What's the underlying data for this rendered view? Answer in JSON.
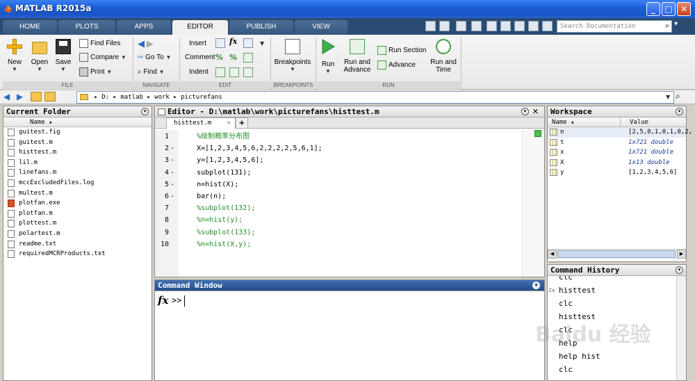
{
  "window": {
    "title": "MATLAB R2015a"
  },
  "tabs": [
    "HOME",
    "PLOTS",
    "APPS",
    "EDITOR",
    "PUBLISH",
    "VIEW"
  ],
  "search": {
    "placeholder": "Search Documentation"
  },
  "ribbon": {
    "file": {
      "new": "New",
      "open": "Open",
      "save": "Save",
      "find_files": "Find Files",
      "compare": "Compare",
      "print": "Print",
      "group": "FILE"
    },
    "navigate": {
      "go_to": "Go To",
      "find": "Find",
      "group": "NAVIGATE"
    },
    "edit": {
      "insert": "Insert",
      "comment": "Comment",
      "indent": "Indent",
      "group": "EDIT"
    },
    "breakpoints": {
      "label": "Breakpoints",
      "group": "BREAKPOINTS"
    },
    "run": {
      "run": "Run",
      "run_and_advance_1": "Run and",
      "run_and_advance_2": "Advance",
      "run_section": "Run Section",
      "advance": "Advance",
      "run_and_time_1": "Run and",
      "run_and_time_2": "Time",
      "group": "RUN"
    }
  },
  "address": {
    "drive": "D:",
    "parts": [
      "matlab",
      "work",
      "picturefans"
    ]
  },
  "current_folder": {
    "title": "Current Folder",
    "column": "Name",
    "files": [
      {
        "name": "guitest.fig",
        "type": "fig"
      },
      {
        "name": "guitest.m",
        "type": "m"
      },
      {
        "name": "histtest.m",
        "type": "m"
      },
      {
        "name": "lil.m",
        "type": "m"
      },
      {
        "name": "linefans.m",
        "type": "m"
      },
      {
        "name": "mccExcludedFiles.log",
        "type": "log"
      },
      {
        "name": "multest.m",
        "type": "m"
      },
      {
        "name": "plotfan.exe",
        "type": "exe"
      },
      {
        "name": "plotfan.m",
        "type": "m"
      },
      {
        "name": "plottest.m",
        "type": "m"
      },
      {
        "name": "polartest.m",
        "type": "m"
      },
      {
        "name": "readme.txt",
        "type": "txt"
      },
      {
        "name": "requiredMCRProducts.txt",
        "type": "txt"
      }
    ]
  },
  "editor": {
    "title": "Editor - D:\\matlab\\work\\picturefans\\histtest.m",
    "tab": "histtest.m",
    "lines": [
      {
        "n": "1",
        "dash": "",
        "code": "    %绘制概率分布图",
        "comment": true
      },
      {
        "n": "2",
        "dash": "-",
        "code": "    X=[1,2,3,4,5,6,2,2,2,2,5,6,1];",
        "comment": false
      },
      {
        "n": "3",
        "dash": "-",
        "code": "    y=[1,2,3,4,5,6];",
        "comment": false
      },
      {
        "n": "4",
        "dash": "-",
        "code": "    subplot(131);",
        "comment": false
      },
      {
        "n": "5",
        "dash": "-",
        "code": "    n=hist(X);",
        "comment": false
      },
      {
        "n": "6",
        "dash": "-",
        "code": "    bar(n);",
        "comment": false
      },
      {
        "n": "7",
        "dash": "",
        "code": "    %subplot(132);",
        "comment": true
      },
      {
        "n": "8",
        "dash": "",
        "code": "    %n=hist(y);",
        "comment": true
      },
      {
        "n": "9",
        "dash": "",
        "code": "    %subplot(133);",
        "comment": true
      },
      {
        "n": "10",
        "dash": "",
        "code": "    %n=hist(X,y);",
        "comment": true
      }
    ]
  },
  "command_window": {
    "title": "Command Window",
    "prompt": ">>"
  },
  "workspace": {
    "title": "Workspace",
    "col_name": "Name",
    "col_value": "Value",
    "vars": [
      {
        "name": "n",
        "value": "[2,5,0,1,0,1,0,2,",
        "italic": false
      },
      {
        "name": "t",
        "value": "1x721 double",
        "italic": true
      },
      {
        "name": "x",
        "value": "1x721 double",
        "italic": true
      },
      {
        "name": "X",
        "value": "1x13 double",
        "italic": true
      },
      {
        "name": "y",
        "value": "[1,2,3,4,5,6]",
        "italic": false
      }
    ]
  },
  "history": {
    "title": "Command History",
    "items": [
      {
        "text": "clc",
        "mark": ""
      },
      {
        "text": "histtest",
        "mark": "2x"
      },
      {
        "text": "clc",
        "mark": ""
      },
      {
        "text": "histtest",
        "mark": ""
      },
      {
        "text": "clc",
        "mark": ""
      },
      {
        "text": "help",
        "mark": ""
      },
      {
        "text": "help hist",
        "mark": ""
      },
      {
        "text": "clc",
        "mark": ""
      }
    ]
  },
  "watermark": "Baidu 经验"
}
